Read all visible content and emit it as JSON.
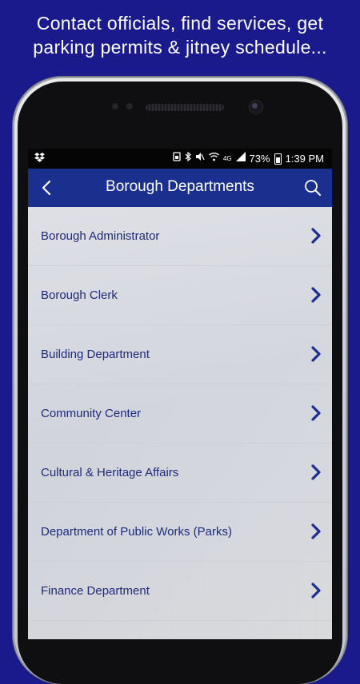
{
  "promo": {
    "line1": "Contact officials, find services, get",
    "line2": "parking permits & jitney schedule..."
  },
  "colors": {
    "background": "#1a1a8c",
    "appbar": "#1b2f8f",
    "list_text": "#1e2a7a",
    "chevron": "#1b2f8f"
  },
  "statusbar": {
    "battery": "73%",
    "time": "1:39 PM",
    "network": "4G",
    "icons": [
      "dropbox-icon",
      "sim-icon",
      "bluetooth-icon",
      "mute-icon",
      "wifi-icon",
      "signal-icon",
      "battery-icon"
    ]
  },
  "appbar": {
    "title": "Borough Departments",
    "back_icon": "back-arrow-icon",
    "search_icon": "search-icon"
  },
  "departments": [
    {
      "label": "Borough Administrator"
    },
    {
      "label": "Borough Clerk"
    },
    {
      "label": "Building Department"
    },
    {
      "label": "Community Center"
    },
    {
      "label": "Cultural & Heritage Affairs"
    },
    {
      "label": "Department of Public Works (Parks)"
    },
    {
      "label": "Finance Department"
    }
  ]
}
